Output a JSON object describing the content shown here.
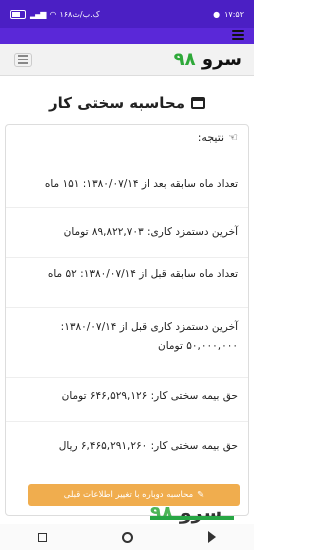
{
  "status_bar": {
    "time": "۱۷:۵۲",
    "speed": "۱۶۸ک.ب/ث"
  },
  "brand": {
    "name": "سرو",
    "number": "۹۸"
  },
  "page_title": "محاسبه سختی کار",
  "result_label": "نتیجه:",
  "results": [
    "تعداد ماه سابقه بعد از ۱۳۸۰/۰۷/۱۴: ۱۵۱ ماه",
    "آخرین دستمزد کاری: ۸۹,۸۲۲,۷۰۳ تومان",
    "تعداد ماه سابقه قبل از ۱۳۸۰/۰۷/۱۴: ۵۲ ماه",
    "آخرین دستمزد کاری قبل از ۱۳۸۰/۰۷/۱۴: ۵۰,۰۰۰,۰۰۰ تومان",
    "حق بیمه سختی کار: ۶۴۶,۵۲۹,۱۲۶ تومان",
    "حق بیمه سختی کار: ۶,۴۶۵,۲۹۱,۲۶۰ ریال"
  ],
  "recalc_button": "محاسبه دوباره با تغییر اطلاعات قبلی",
  "colors": {
    "status_bar": "#4b1fc4",
    "accent_green": "#2fa93a",
    "button_warning": "#f0ad4e"
  }
}
